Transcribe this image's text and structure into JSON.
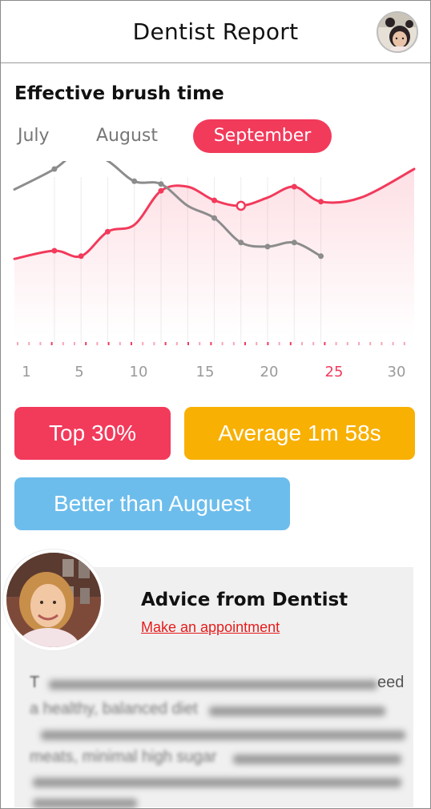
{
  "header": {
    "title": "Dentist Report"
  },
  "section": {
    "title": "Effective brush time"
  },
  "tabs": [
    {
      "label": "July",
      "selected": false
    },
    {
      "label": "August",
      "selected": false
    },
    {
      "label": "September",
      "selected": true
    }
  ],
  "chart_data": {
    "type": "line",
    "x_ticks": [
      "1",
      "5",
      "10",
      "15",
      "20",
      "25",
      "30"
    ],
    "highlighted_tick": "25",
    "xlim": [
      1,
      31
    ],
    "ylim": [
      0,
      10
    ],
    "grid": false,
    "series": [
      {
        "color": "#f23a5b",
        "area": true,
        "x": [
          1,
          4,
          6,
          8,
          10,
          12,
          14,
          16,
          18,
          20,
          22,
          24,
          27,
          31
        ],
        "y": [
          3.4,
          4.0,
          3.6,
          5.4,
          5.9,
          8.4,
          8.7,
          7.7,
          7.3,
          7.9,
          8.7,
          7.6,
          7.9,
          10.0
        ],
        "markers": [
          4,
          6,
          8,
          12,
          16,
          18,
          22,
          24
        ],
        "hollow_marker": 18
      },
      {
        "color": "#8c8c8c",
        "area": false,
        "x": [
          1,
          4,
          6,
          8,
          10,
          12,
          14,
          16,
          18,
          20,
          22,
          24
        ],
        "y": [
          8.5,
          10.0,
          11.4,
          10.6,
          9.1,
          8.9,
          7.3,
          6.4,
          4.6,
          4.3,
          4.6,
          3.6
        ],
        "markers": [
          4,
          6,
          10,
          12,
          16,
          18,
          20,
          22,
          24
        ]
      }
    ]
  },
  "stats": {
    "top_label": "Top 30%",
    "average_label": "Average 1m 58s",
    "better_label": "Better than Auguest"
  },
  "advice": {
    "title": "Advice from Dentist",
    "link": "Make an appointment",
    "text_visible_start": "T",
    "text_visible_end": "eed",
    "text_line2": "a healthy, balanced diet",
    "text_line4": "meats, minimal high sugar"
  },
  "colors": {
    "accent": "#f23a5b",
    "average": "#f8b003",
    "better": "#6cbdec",
    "grey_series": "#8c8c8c"
  }
}
